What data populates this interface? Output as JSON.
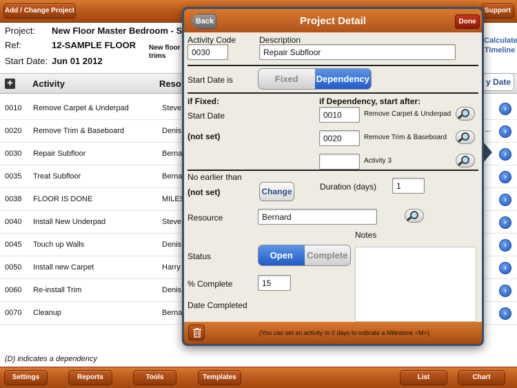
{
  "topbar": {
    "add_change_project": "Add / Change Project",
    "support": "Support"
  },
  "header": {
    "project_label": "Project:",
    "project_value": "New Floor Master Bedroom - Sm",
    "ref_label": "Ref:",
    "ref_value": "12-SAMPLE FLOOR",
    "start_label": "Start Date:",
    "start_value": "Jun 01 2012",
    "notes_small": "New floor\ntrims",
    "calculate_button": "Calculate\nTimeline"
  },
  "columns": {
    "activity": "Activity",
    "resource": "Reso",
    "sort_button": "y Date"
  },
  "rows": [
    {
      "code": "0010",
      "activity": "Remove Carpet & Underpad",
      "resource": "Steve"
    },
    {
      "code": "0020",
      "activity": "Remove Trim & Baseboard",
      "resource": "Denis"
    },
    {
      "code": "0030",
      "activity": "Repair Subfloor",
      "resource": "Berna"
    },
    {
      "code": "0035",
      "activity": "Treat Subfloor",
      "resource": "Berna"
    },
    {
      "code": "0038",
      "activity": "FLOOR IS DONE",
      "resource": "MILES"
    },
    {
      "code": "0040",
      "activity": "Install New Underpad",
      "resource": "Steve"
    },
    {
      "code": "0045",
      "activity": "Touch up Walls",
      "resource": "Denis"
    },
    {
      "code": "0050",
      "activity": "Install new Carpet",
      "resource": "Harry"
    },
    {
      "code": "0060",
      "activity": "Re-install Trim",
      "resource": "Denis"
    },
    {
      "code": "0070",
      "activity": "Cleanup",
      "resource": "Berna"
    }
  ],
  "row_ellipsis": "...",
  "dependency_note": "(D) indicates a dependency",
  "bottombar": {
    "settings": "Settings",
    "reports": "Reports",
    "tools": "Tools",
    "templates": "Templates",
    "list": "List",
    "chart": "Chart"
  },
  "modal": {
    "title": "Project Detail",
    "back": "Back",
    "done": "Done",
    "activity_code_label": "Activity Code",
    "activity_code_value": "0030",
    "description_label": "Description",
    "description_value": "Repair Subfloor",
    "start_date_is_label": "Start Date is",
    "start_mode": {
      "fixed": "Fixed",
      "dependency": "Dependency",
      "selected": "Dependency"
    },
    "if_fixed_label": "if Fixed:",
    "start_date_label": "Start Date",
    "start_date_value": "(not set)",
    "if_dependency_label": "if Dependency, start after:",
    "dependencies": [
      {
        "code": "0010",
        "name": "Remove Carpet & Underpad"
      },
      {
        "code": "0020",
        "name": "Remove Trim & Baseboard"
      },
      {
        "code": "",
        "name": "Activity 3"
      }
    ],
    "no_earlier_than_label": "No earlier than",
    "no_earlier_than_value": "(not set)",
    "change_button": "Change",
    "duration_label": "Duration (days)",
    "duration_value": "1",
    "resource_label": "Resource",
    "resource_value": "Bernard",
    "notes_label": "Notes",
    "status_label": "Status",
    "status": {
      "open": "Open",
      "complete": "Complete",
      "selected": "Open"
    },
    "percent_complete_label": "% Complete",
    "percent_complete_value": "15",
    "date_completed_label": "Date Completed",
    "footer_hint": "(You can set an activity to 0 days to indicate a Milestone <M>)"
  }
}
